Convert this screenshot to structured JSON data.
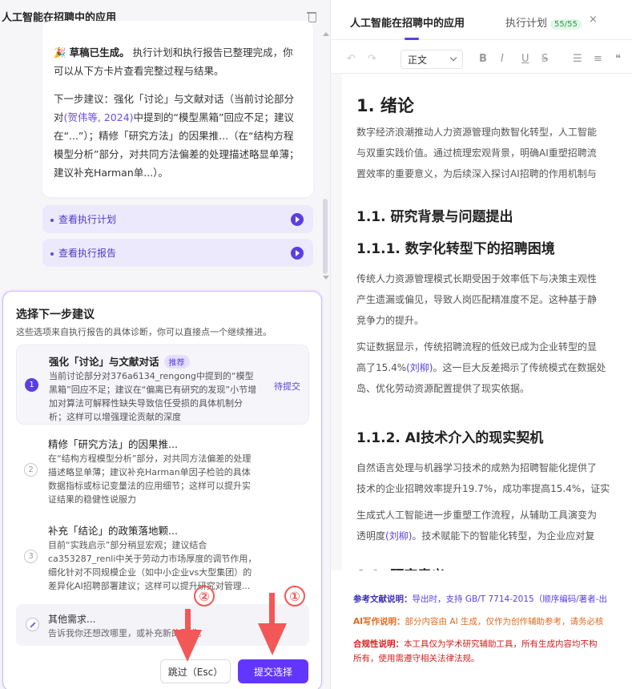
{
  "left": {
    "title": "人工智能在招聘中的应用",
    "message": {
      "emoji": "🎉",
      "headline": "草稿已生成。",
      "line1": "执行计划和执行报告已整理完成，你可以从下方卡片查看完整过程与结果。",
      "next_prefix": "下一步建议：强化「讨论」与文献对话（当前讨论部分对",
      "citation": "(贺伟等, 2024)",
      "next_suffix": "中提到的“模型黑箱”回应不足；建议在“...”）；精修「研究方法」的因果推...（在“结构方程模型分析”部分，对共同方法偏差的处理描述略显单薄；建议补充Harman单...）。"
    },
    "links": [
      {
        "label": "查看执行计划"
      },
      {
        "label": "查看执行报告"
      }
    ],
    "suggestions": {
      "title": "选择下一步建议",
      "subtitle": "这些选项来自执行报告的具体诊断，你可以直接点一个继续推进。",
      "options": [
        {
          "num": "1",
          "title": "强化「讨论」与文献对话",
          "badge": "推荐",
          "status": "待提交",
          "desc": "当前讨论部分对376a6134_rengong中提到的“模型黑箱”回应不足；建议在“偏离已有研究的发现”小节增加对算法可解释性缺失导致信任受损的具体机制分析；这样可以增强理论贡献的深度"
        },
        {
          "num": "2",
          "title": "精修「研究方法」的因果推...",
          "desc": "在“结构方程模型分析”部分，对共同方法偏差的处理描述略显单薄；建议补充Harman单因子检验的具体数据指标或标记变量法的应用细节；这样可以提升实证结果的稳健性说服力"
        },
        {
          "num": "3",
          "title": "补充「结论」的政策落地颗...",
          "desc": "目前“实践启示”部分稍显宏观；建议结合ca353287_renli中关于劳动力市场厚度的调节作用，细化针对不同规模企业（如中小企业vs大型集团）的差异化AI招聘部署建议；这样可以提升研究对管理..."
        }
      ],
      "other_title": "其他需求...",
      "other_desc": "告诉我你还想改哪里，或补充新的要求。",
      "skip_label": "跳过（Esc）",
      "submit_label": "提交选择"
    },
    "annotations": {
      "one": "①",
      "two": "②"
    }
  },
  "right": {
    "tabs": [
      {
        "label": "人工智能在招聘中的应用"
      },
      {
        "label": "执行计划",
        "count": "55/55"
      }
    ],
    "tab_close": "×",
    "toolbar": {
      "undo": "↶",
      "redo": "↷",
      "style": "正文",
      "bold": "B",
      "italic": "I",
      "underline": "U",
      "strike": "S",
      "ul": "☰",
      "ol": "≡",
      "quote": "❝"
    },
    "doc": {
      "h1": "1. 绪论",
      "p1": [
        "数字经济浪潮推动人力资源管理向数智化转型，人工智能",
        "与双重实践价值。通过梳理宏观背景，明确AI重塑招聘流",
        "置效率的重要意义，为后续深入探讨AI招聘的作用机制与"
      ],
      "h2a": "1.1. 研究背景与问题提出",
      "h3a": "1.1.1. 数字化转型下的招聘困境",
      "p2": [
        "传统人力资源管理模式长期受困于效率低下与决策主观性",
        "产生遗漏或偏见，导致人岗匹配精准度不足。这种基于静",
        "竞争力的提升。"
      ],
      "p3a": "实证数据显示，传统招聘流程的低效已成为企业转型的显",
      "p3b_pre": "高了15.4%",
      "p3b_link": "(刘柳)",
      "p3b_post": "。这一巨大反差揭示了传统模式在数据处",
      "p3c": "岛、优化劳动资源配置提供了现实依据。",
      "h3b": "1.1.2. AI技术介入的现实契机",
      "p4": [
        "自然语言处理与机器学习技术的成熟为招聘智能化提供了",
        "技术的企业招聘效率提升19.7%，成功率提高15.4%，证实"
      ],
      "p5a": "生成式人工智能进一步重塑工作流程，从辅助工具演变为",
      "p5b_pre": "透明度",
      "p5b_link": "(刘柳)",
      "p5b_post": "。技术赋能下的智能化转型，为企业应对复",
      "h2b": "1.2. 研究意义"
    },
    "notes": {
      "n1_label": "参考文献说明：",
      "n1_text": "导出时，支持 GB/T 7714-2015（顺序编码/著者-出",
      "n2_label": "AI写作说明：",
      "n2_text": "部分内容由 AI 生成，仅作为创作辅助参考，请务必核",
      "n3_label": "合规性说明：",
      "n3_text": "本工具仅为学术研究辅助工具，所有生成内容均不构",
      "n3_line2": "所有，使用需遵守相关法律法规。"
    }
  }
}
